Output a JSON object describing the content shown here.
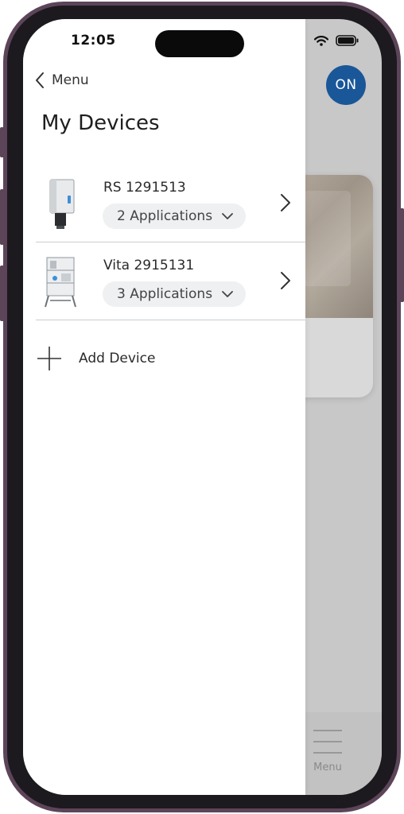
{
  "status_bar": {
    "time": "12:05"
  },
  "drawer": {
    "back_label": "Menu",
    "title": "My Devices",
    "devices": [
      {
        "name": "RS 1291513",
        "applications": "2 Applications"
      },
      {
        "name": "Vita 2915131",
        "applications": "3 Applications"
      }
    ],
    "add_device_label": "Add Device"
  },
  "background_app": {
    "power_button_label": "ON",
    "tab_bar": {
      "menu_label": "Menu"
    }
  },
  "colors": {
    "accent": "#1a5799",
    "frame": "#5c4459",
    "divider": "#c9cdd0",
    "pill": "#eef0f1"
  }
}
